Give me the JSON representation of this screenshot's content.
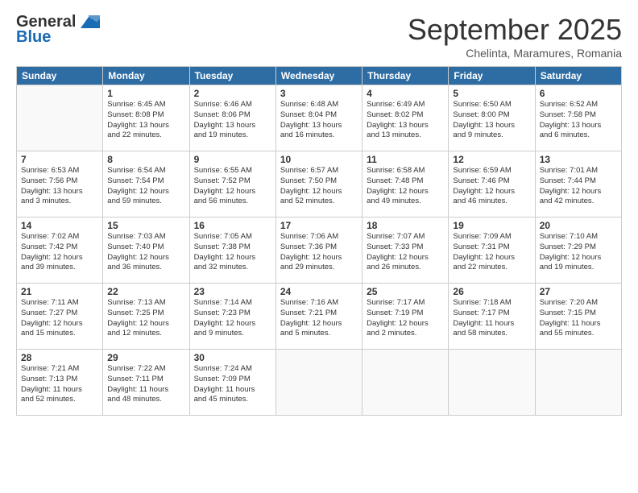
{
  "header": {
    "logo_general": "General",
    "logo_blue": "Blue",
    "month_title": "September 2025",
    "subtitle": "Chelinta, Maramures, Romania"
  },
  "weekdays": [
    "Sunday",
    "Monday",
    "Tuesday",
    "Wednesday",
    "Thursday",
    "Friday",
    "Saturday"
  ],
  "weeks": [
    [
      {
        "day": "",
        "info": ""
      },
      {
        "day": "1",
        "info": "Sunrise: 6:45 AM\nSunset: 8:08 PM\nDaylight: 13 hours\nand 22 minutes."
      },
      {
        "day": "2",
        "info": "Sunrise: 6:46 AM\nSunset: 8:06 PM\nDaylight: 13 hours\nand 19 minutes."
      },
      {
        "day": "3",
        "info": "Sunrise: 6:48 AM\nSunset: 8:04 PM\nDaylight: 13 hours\nand 16 minutes."
      },
      {
        "day": "4",
        "info": "Sunrise: 6:49 AM\nSunset: 8:02 PM\nDaylight: 13 hours\nand 13 minutes."
      },
      {
        "day": "5",
        "info": "Sunrise: 6:50 AM\nSunset: 8:00 PM\nDaylight: 13 hours\nand 9 minutes."
      },
      {
        "day": "6",
        "info": "Sunrise: 6:52 AM\nSunset: 7:58 PM\nDaylight: 13 hours\nand 6 minutes."
      }
    ],
    [
      {
        "day": "7",
        "info": "Sunrise: 6:53 AM\nSunset: 7:56 PM\nDaylight: 13 hours\nand 3 minutes."
      },
      {
        "day": "8",
        "info": "Sunrise: 6:54 AM\nSunset: 7:54 PM\nDaylight: 12 hours\nand 59 minutes."
      },
      {
        "day": "9",
        "info": "Sunrise: 6:55 AM\nSunset: 7:52 PM\nDaylight: 12 hours\nand 56 minutes."
      },
      {
        "day": "10",
        "info": "Sunrise: 6:57 AM\nSunset: 7:50 PM\nDaylight: 12 hours\nand 52 minutes."
      },
      {
        "day": "11",
        "info": "Sunrise: 6:58 AM\nSunset: 7:48 PM\nDaylight: 12 hours\nand 49 minutes."
      },
      {
        "day": "12",
        "info": "Sunrise: 6:59 AM\nSunset: 7:46 PM\nDaylight: 12 hours\nand 46 minutes."
      },
      {
        "day": "13",
        "info": "Sunrise: 7:01 AM\nSunset: 7:44 PM\nDaylight: 12 hours\nand 42 minutes."
      }
    ],
    [
      {
        "day": "14",
        "info": "Sunrise: 7:02 AM\nSunset: 7:42 PM\nDaylight: 12 hours\nand 39 minutes."
      },
      {
        "day": "15",
        "info": "Sunrise: 7:03 AM\nSunset: 7:40 PM\nDaylight: 12 hours\nand 36 minutes."
      },
      {
        "day": "16",
        "info": "Sunrise: 7:05 AM\nSunset: 7:38 PM\nDaylight: 12 hours\nand 32 minutes."
      },
      {
        "day": "17",
        "info": "Sunrise: 7:06 AM\nSunset: 7:36 PM\nDaylight: 12 hours\nand 29 minutes."
      },
      {
        "day": "18",
        "info": "Sunrise: 7:07 AM\nSunset: 7:33 PM\nDaylight: 12 hours\nand 26 minutes."
      },
      {
        "day": "19",
        "info": "Sunrise: 7:09 AM\nSunset: 7:31 PM\nDaylight: 12 hours\nand 22 minutes."
      },
      {
        "day": "20",
        "info": "Sunrise: 7:10 AM\nSunset: 7:29 PM\nDaylight: 12 hours\nand 19 minutes."
      }
    ],
    [
      {
        "day": "21",
        "info": "Sunrise: 7:11 AM\nSunset: 7:27 PM\nDaylight: 12 hours\nand 15 minutes."
      },
      {
        "day": "22",
        "info": "Sunrise: 7:13 AM\nSunset: 7:25 PM\nDaylight: 12 hours\nand 12 minutes."
      },
      {
        "day": "23",
        "info": "Sunrise: 7:14 AM\nSunset: 7:23 PM\nDaylight: 12 hours\nand 9 minutes."
      },
      {
        "day": "24",
        "info": "Sunrise: 7:16 AM\nSunset: 7:21 PM\nDaylight: 12 hours\nand 5 minutes."
      },
      {
        "day": "25",
        "info": "Sunrise: 7:17 AM\nSunset: 7:19 PM\nDaylight: 12 hours\nand 2 minutes."
      },
      {
        "day": "26",
        "info": "Sunrise: 7:18 AM\nSunset: 7:17 PM\nDaylight: 11 hours\nand 58 minutes."
      },
      {
        "day": "27",
        "info": "Sunrise: 7:20 AM\nSunset: 7:15 PM\nDaylight: 11 hours\nand 55 minutes."
      }
    ],
    [
      {
        "day": "28",
        "info": "Sunrise: 7:21 AM\nSunset: 7:13 PM\nDaylight: 11 hours\nand 52 minutes."
      },
      {
        "day": "29",
        "info": "Sunrise: 7:22 AM\nSunset: 7:11 PM\nDaylight: 11 hours\nand 48 minutes."
      },
      {
        "day": "30",
        "info": "Sunrise: 7:24 AM\nSunset: 7:09 PM\nDaylight: 11 hours\nand 45 minutes."
      },
      {
        "day": "",
        "info": ""
      },
      {
        "day": "",
        "info": ""
      },
      {
        "day": "",
        "info": ""
      },
      {
        "day": "",
        "info": ""
      }
    ]
  ]
}
